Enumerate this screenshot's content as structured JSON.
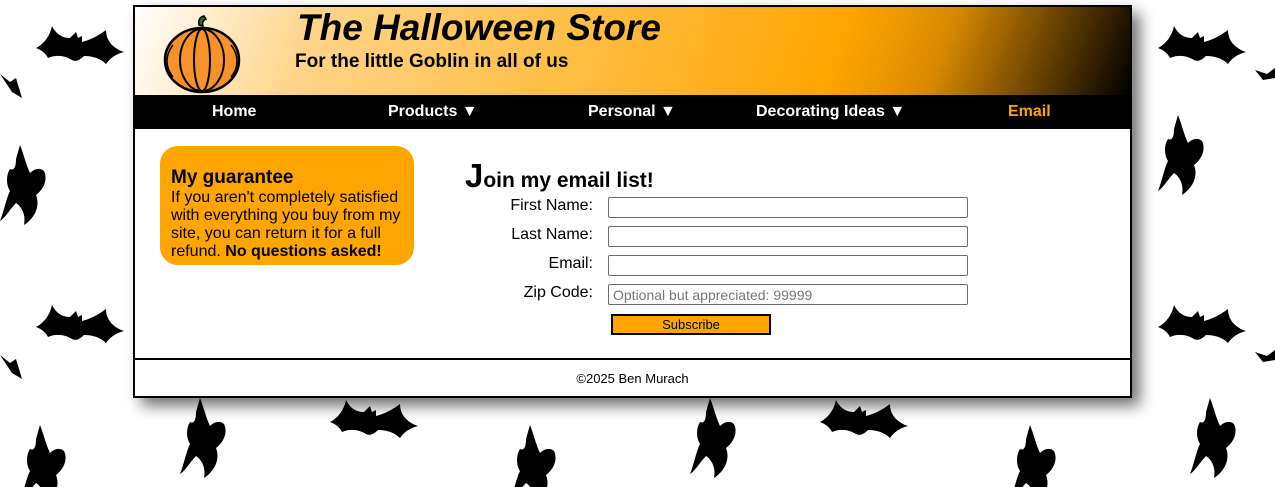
{
  "header": {
    "title": "The Halloween Store",
    "subtitle": "For the little Goblin in all of us",
    "logo_icon": "pumpkin-icon"
  },
  "nav": {
    "items": [
      {
        "label": "Home"
      },
      {
        "label": "Products ▼"
      },
      {
        "label": "Personal ▼"
      },
      {
        "label": "Decorating Ideas ▼"
      },
      {
        "label": "Email"
      }
    ],
    "current": "Email",
    "current_color": "#ffa500"
  },
  "guarantee": {
    "heading": "My guarantee",
    "body": "If you aren't completely satisfied with everything you buy from my site, you can return it for a full refund. ",
    "emphasis": "No questions asked!"
  },
  "form": {
    "title_initial": "J",
    "title_rest": "oin my email list!",
    "fields": [
      {
        "label": "First Name:",
        "value": "",
        "placeholder": ""
      },
      {
        "label": "Last Name:",
        "value": "",
        "placeholder": ""
      },
      {
        "label": "Email:",
        "value": "",
        "placeholder": ""
      },
      {
        "label": "Zip Code:",
        "value": "",
        "placeholder": "Optional but appreciated: 99999"
      }
    ],
    "submit_label": "Subscribe"
  },
  "footer": {
    "copyright": "©2025 Ben Murach"
  },
  "colors": {
    "accent": "#ffa500",
    "nav_background": "#000000",
    "background_pattern": "bat-icon"
  }
}
